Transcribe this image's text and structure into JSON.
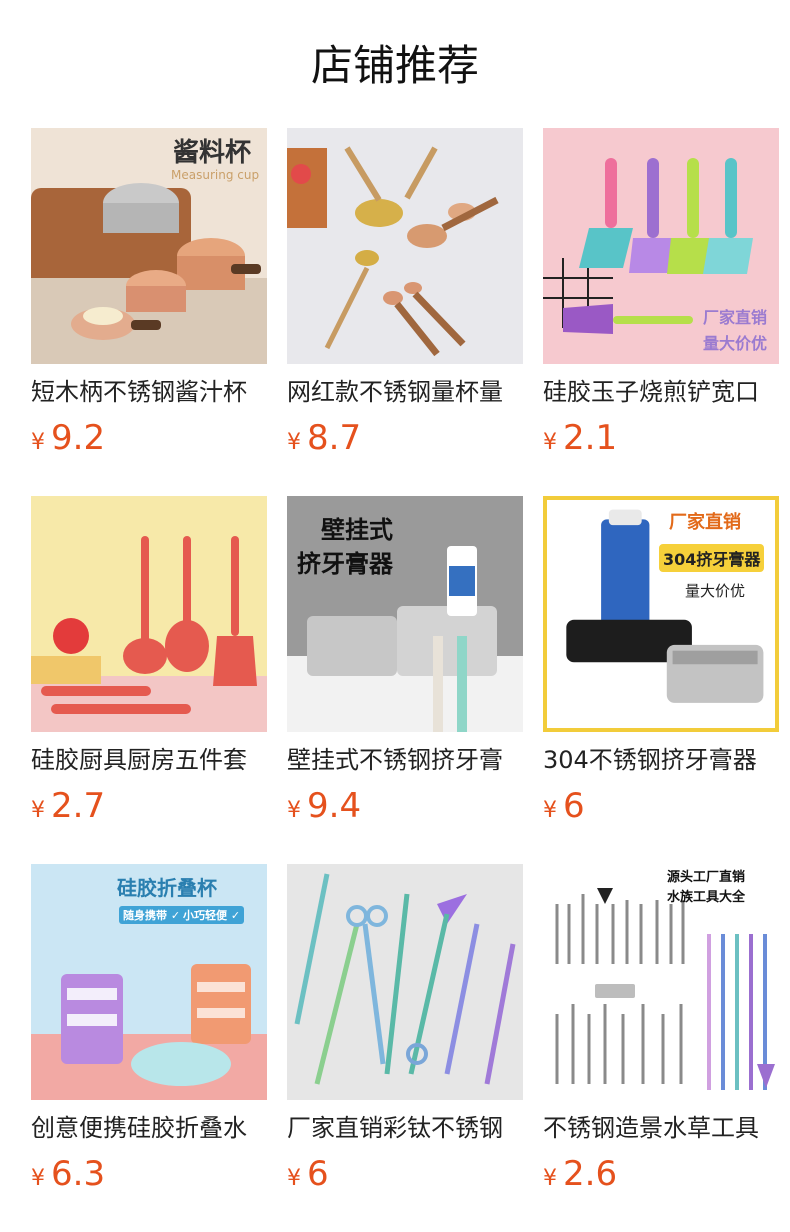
{
  "page": {
    "title": "店铺推荐"
  },
  "currency_symbol": "¥",
  "products": [
    {
      "name": "短木柄不锈钢酱汁杯",
      "price": "9.2",
      "overlay": [
        "酱料杯",
        "Measuring cup"
      ],
      "overlay_color": "#333333",
      "image_icon": "measuring-cups-image"
    },
    {
      "name": "网红款不锈钢量杯量",
      "price": "8.7",
      "overlay": [],
      "overlay_color": "#777777",
      "image_icon": "gold-measuring-spoons-image"
    },
    {
      "name": "硅胶玉子烧煎铲宽口",
      "price": "2.1",
      "overlay": [
        "厂家直销",
        "量大价优"
      ],
      "overlay_color": "#9b7bd0",
      "image_icon": "silicone-spatulas-image"
    },
    {
      "name": "硅胶厨具厨房五件套",
      "price": "2.7",
      "overlay": [],
      "overlay_color": "#ffffff",
      "image_icon": "red-silicone-utensils-image"
    },
    {
      "name": "壁挂式不锈钢挤牙膏",
      "price": "9.4",
      "overlay": [
        "壁挂式",
        "挤牙膏器"
      ],
      "overlay_color": "#111111",
      "image_icon": "wall-toothpaste-squeezer-image"
    },
    {
      "name": "304不锈钢挤牙膏器",
      "price": "6",
      "overlay": [
        "厂家直销",
        "304挤牙膏器",
        "量大价优"
      ],
      "overlay_color": "#e26a1a",
      "image_icon": "toothpaste-roller-image"
    },
    {
      "name": "创意便携硅胶折叠水",
      "price": "6.3",
      "overlay": [
        "硅胶折叠杯",
        "随身携带 ✓",
        "小巧轻便 ✓"
      ],
      "overlay_color": "#2a7fb0",
      "image_icon": "folding-silicone-cups-image"
    },
    {
      "name": "厂家直销彩钛不锈钢",
      "price": "6",
      "overlay": [],
      "overlay_color": "#999999",
      "image_icon": "rainbow-titanium-tools-image"
    },
    {
      "name": "不锈钢造景水草工具",
      "price": "2.6",
      "overlay": [
        "源头工厂直销",
        "水族工具大全"
      ],
      "overlay_color": "#111111",
      "image_icon": "aquascape-tools-image"
    }
  ],
  "colors": {
    "price": "#e5511d",
    "title": "#111111"
  }
}
